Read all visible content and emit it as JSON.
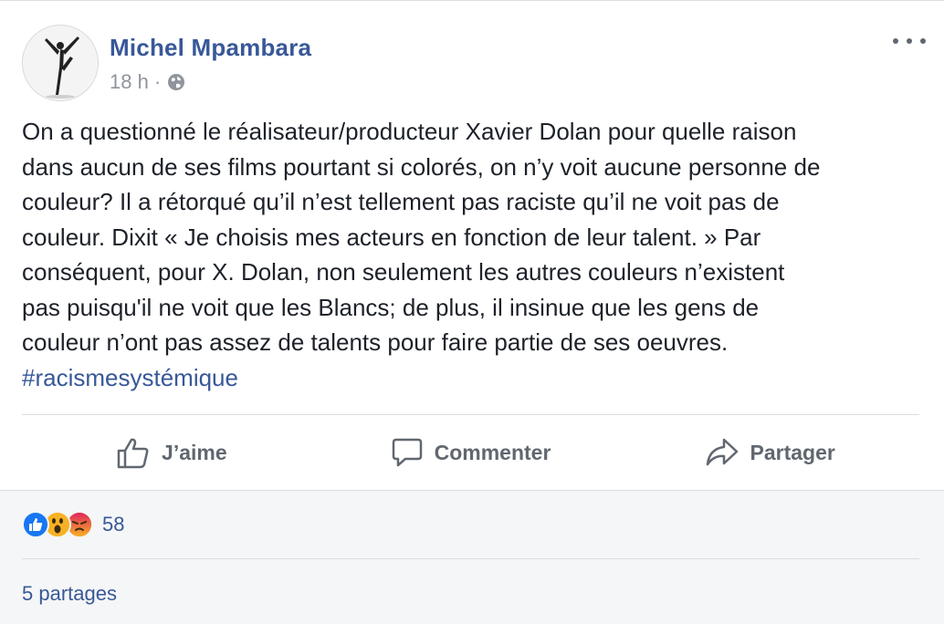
{
  "post": {
    "author": "Michel Mpambara",
    "time": "18 h",
    "separator": "·",
    "privacy_icon": "globe-icon",
    "more_icon": "more-options-icon",
    "text_lines": [
      "On a questionné le réalisateur/producteur Xavier Dolan pour quelle raison",
      "dans aucun de ses films pourtant si colorés, on n’y voit aucune personne de",
      "couleur? Il a rétorqué qu’il n’est tellement pas raciste qu’il ne voit pas de",
      "couleur. Dixit « Je choisis mes acteurs en fonction de leur talent. » Par",
      "conséquent, pour X. Dolan, non seulement les autres couleurs n’existent",
      "pas puisqu'il ne voit que les Blancs; de plus, il insinue que les gens de",
      "couleur n’ont pas assez de talents pour faire partie de ses oeuvres."
    ],
    "hashtag": "#racismesystémique"
  },
  "actions": {
    "like_label": "J’aime",
    "comment_label": "Commenter",
    "share_label": "Partager"
  },
  "footer": {
    "reaction_icons": [
      "like-reaction-icon",
      "wow-reaction-icon",
      "angry-reaction-icon"
    ],
    "reaction_count": "58",
    "shares": "5 partages"
  },
  "colors": {
    "link": "#385898",
    "text": "#1d2129",
    "muted": "#606770",
    "like_blue": "#1877f2",
    "emoji_yellow": "#f7b125",
    "angry_orange": "#e9710f"
  }
}
